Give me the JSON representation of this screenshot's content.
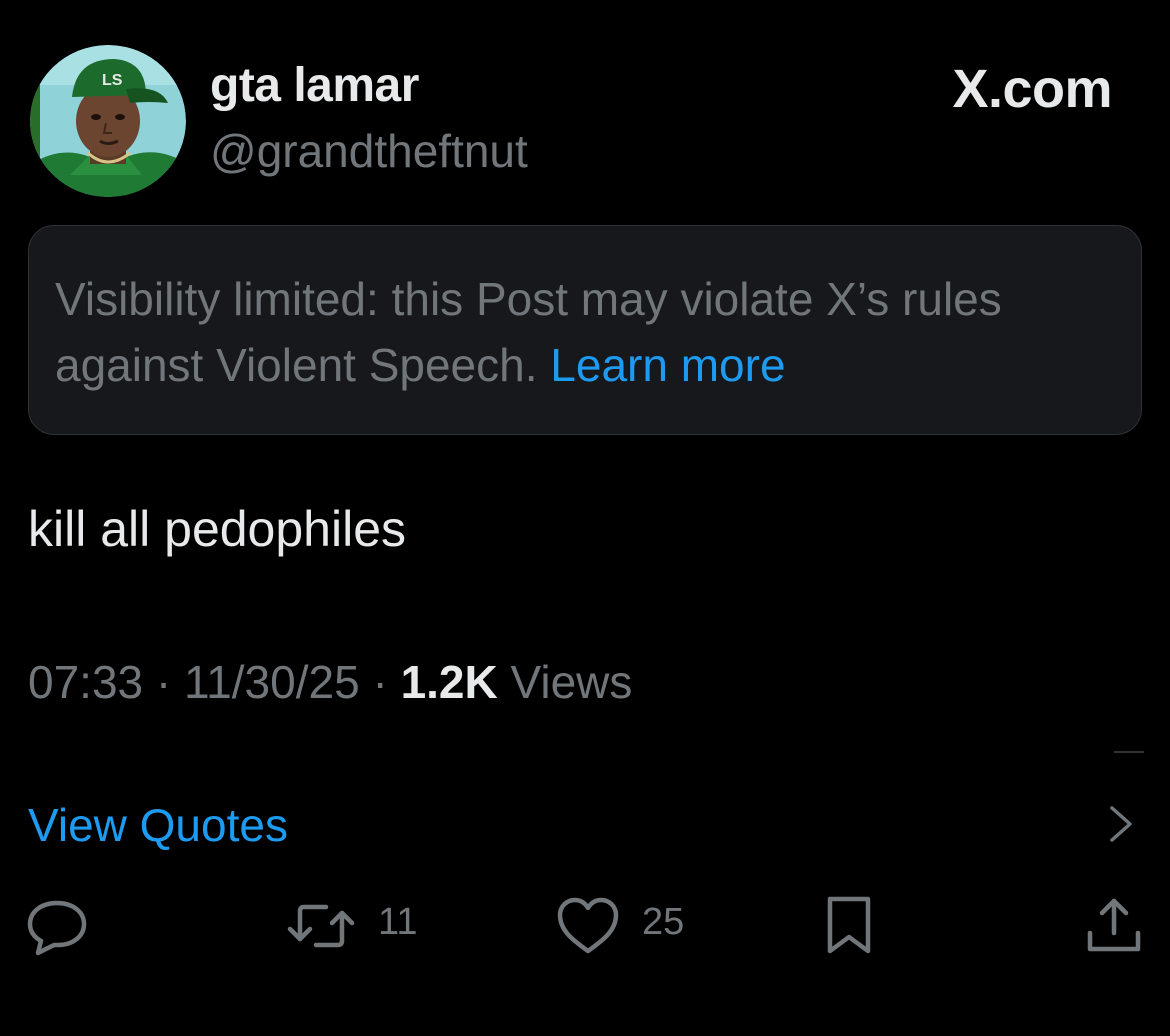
{
  "header": {
    "display_name": "gta lamar",
    "handle": "@grandtheftnut",
    "brand": "X.com",
    "avatar_icon": "profile-avatar",
    "avatar_cap_text": "LS"
  },
  "notice": {
    "text": "Visibility limited: this Post may violate X’s rules against Violent Speech.",
    "link": "Learn more"
  },
  "post": {
    "text": "kill all pedophiles",
    "time": "07:33",
    "separator": "·",
    "date": "11/30/25",
    "views_count": "1.2K",
    "views_label": "Views"
  },
  "quotes": {
    "label": "View Quotes",
    "icon": "chevron-right-icon"
  },
  "actions": {
    "reply": {
      "icon": "reply-icon",
      "count": ""
    },
    "repost": {
      "icon": "repost-icon",
      "count": "11"
    },
    "like": {
      "icon": "heart-icon",
      "count": "25"
    },
    "bookmark": {
      "icon": "bookmark-icon",
      "count": ""
    },
    "share": {
      "icon": "share-icon",
      "count": ""
    }
  },
  "colors": {
    "background": "#000000",
    "primary_text": "#e7e9ea",
    "secondary_text": "#71767b",
    "accent": "#1d9bf0",
    "notice_bg": "#16181c",
    "border": "#2f3336"
  }
}
